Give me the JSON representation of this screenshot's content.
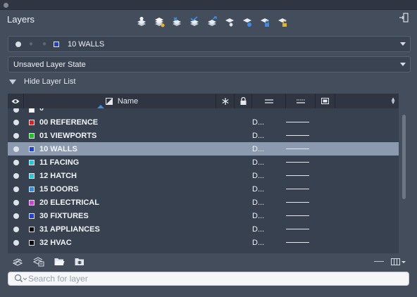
{
  "panel": {
    "title": "Layers"
  },
  "toolbar": {
    "icons": [
      "new-layer-icon",
      "new-layer-vp-frozen-icon",
      "delete-layer-icon",
      "set-current-icon",
      "move-to-layer-icon",
      "freeze-all-icon",
      "isolate-icon",
      "lock-icon",
      "unlock-icon"
    ]
  },
  "current_layer": {
    "name": "10 WALLS",
    "color": "#1f3fdb"
  },
  "layer_state": {
    "value": "Unsaved Layer State"
  },
  "hide_list": {
    "label": "Hide Layer List"
  },
  "grid": {
    "columns": {
      "name": "Name"
    },
    "partial_top": "0",
    "rows": [
      {
        "name": "00 REFERENCE",
        "color": "#e02020",
        "linetype": "D..."
      },
      {
        "name": "01 VIEWPORTS",
        "color": "#1fc31f",
        "linetype": "D..."
      },
      {
        "name": "10 WALLS",
        "color": "#1f3fdb",
        "linetype": "D...",
        "selected": true
      },
      {
        "name": "11 FACING",
        "color": "#27c7d9",
        "linetype": "D..."
      },
      {
        "name": "12 HATCH",
        "color": "#27c7d9",
        "linetype": "D..."
      },
      {
        "name": "15 DOORS",
        "color": "#2f8ce3",
        "linetype": "D..."
      },
      {
        "name": "20 ELECTRICAL",
        "color": "#d43ce0",
        "linetype": "D..."
      },
      {
        "name": "30 FIXTURES",
        "color": "#1f3fdb",
        "linetype": "D..."
      },
      {
        "name": "31 APPLIANCES",
        "color": "#0a0a0a",
        "linetype": "D..."
      },
      {
        "name": "32 HVAC",
        "color": "#0a0a0a",
        "linetype": "D..."
      }
    ]
  },
  "search": {
    "placeholder": "Search for layer"
  }
}
